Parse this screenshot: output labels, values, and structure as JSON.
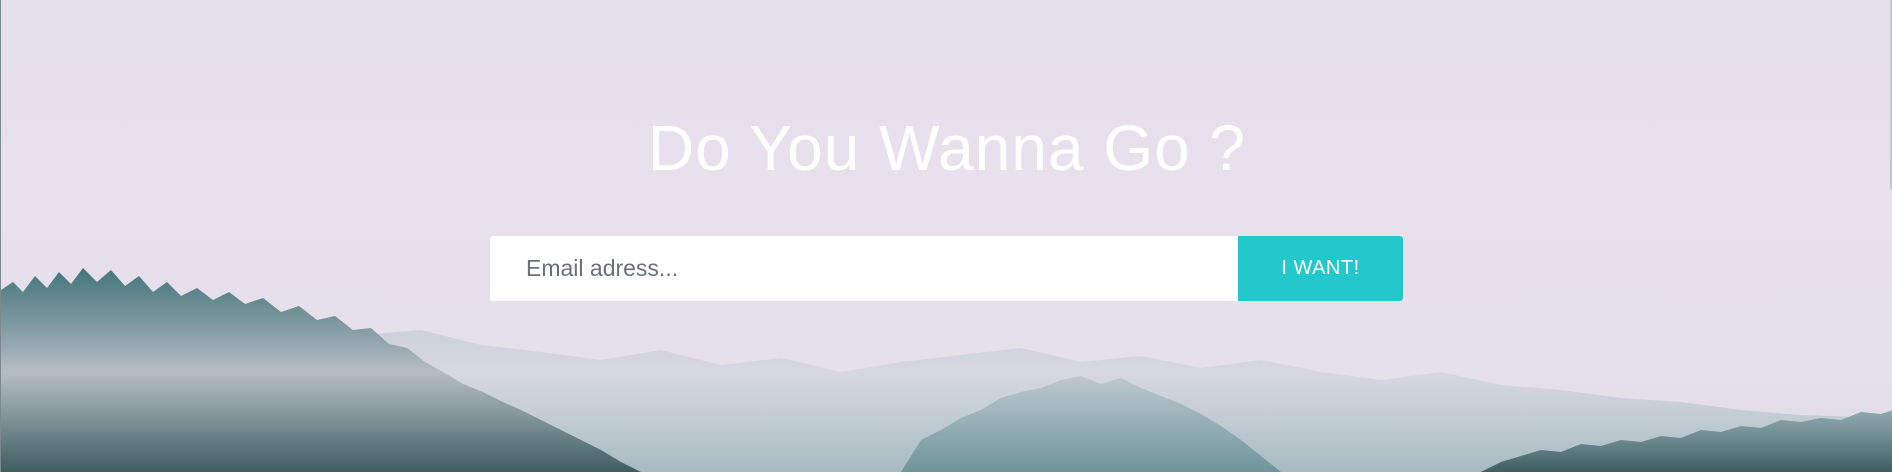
{
  "hero": {
    "headline": "Do You Wanna Go ?",
    "background": "misty-forest-image"
  },
  "signup": {
    "email_placeholder": "Email adress...",
    "email_value": "",
    "submit_label": "I WANT!"
  },
  "colors": {
    "accent": "#22c8cc",
    "sky": "#e6dfec",
    "forest_dark": "#1f4a4e",
    "forest_mid": "#3f7478"
  }
}
